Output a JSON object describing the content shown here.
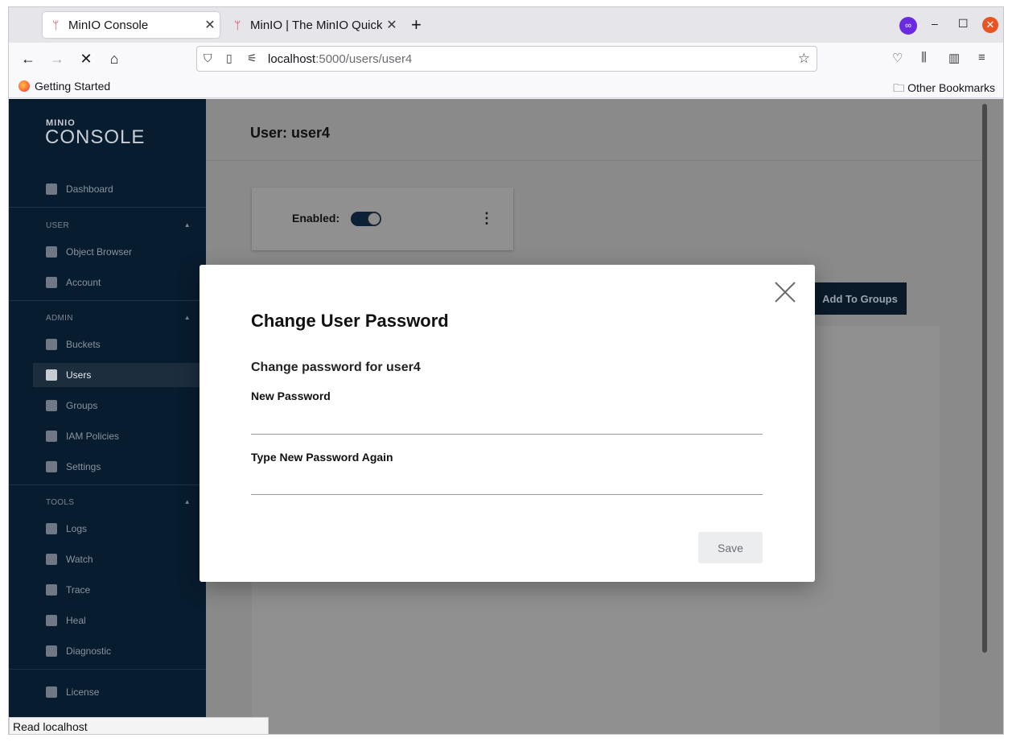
{
  "browser": {
    "tabs": [
      {
        "label": "MinIO Console",
        "active": true
      },
      {
        "label": "MinIO | The MinIO Quicks",
        "active": false
      }
    ],
    "new_tab": "+",
    "url_host": "localhost",
    "url_path": ":5000/users/user4",
    "bookmarks_left": "Getting Started",
    "bookmarks_right": "Other Bookmarks",
    "status": "Read localhost"
  },
  "sidebar": {
    "logo_small": "MINIO",
    "logo_big": "CONSOLE",
    "dashboard": "Dashboard",
    "user_header": "USER",
    "user_items": [
      "Object Browser",
      "Account"
    ],
    "admin_header": "ADMIN",
    "admin_items": [
      "Buckets",
      "Users",
      "Groups",
      "IAM Policies",
      "Settings"
    ],
    "tools_header": "TOOLS",
    "tools_items": [
      "Logs",
      "Watch",
      "Trace",
      "Heal",
      "Diagnostic"
    ],
    "license": "License",
    "selected": "Users"
  },
  "main": {
    "title": "User: user4",
    "enabled_label": "Enabled:",
    "enabled": true,
    "add_to_groups": "Add To Groups"
  },
  "modal": {
    "title": "Change User Password",
    "subtitle": "Change password for user4",
    "new_password_label": "New Password",
    "new_password_value": "",
    "repeat_password_label": "Type New Password Again",
    "repeat_password_value": "",
    "save_label": "Save"
  }
}
